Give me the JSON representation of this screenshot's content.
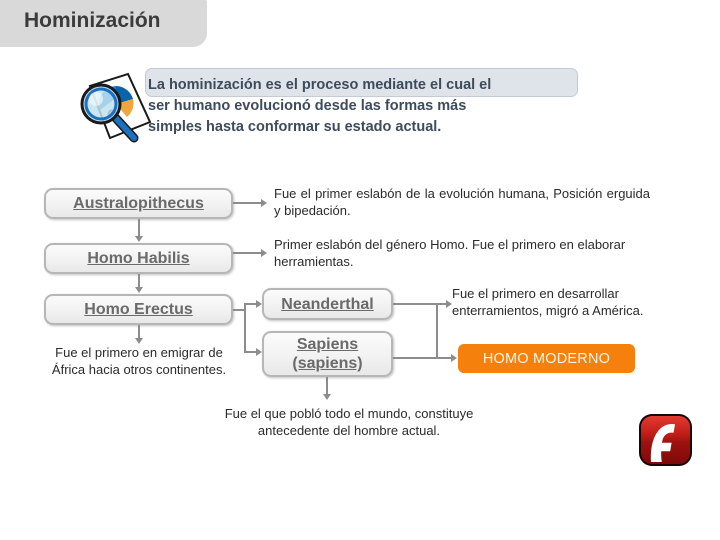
{
  "slide": {
    "title": "Hominización",
    "background_color": "#ffffff",
    "title_tab_color": "#d9d9d9"
  },
  "intro": {
    "icon": "magnifier-document-icon",
    "panel_color": "#dfe4ea",
    "text_color": "#3d4b5c",
    "text": "La hominización es el proceso mediante el cual el\nser humano evolucionó desde las formas más\nsimples hasta conformar su estado actual."
  },
  "diagram": {
    "node_border_color": "#b6b6b6",
    "node_text_color": "#6a6a6a",
    "connector_color": "#8c8c8c",
    "nodes": [
      {
        "id": "australopithecus",
        "label": "Australopithecus"
      },
      {
        "id": "homo-habilis",
        "label": "Homo Habilis"
      },
      {
        "id": "homo-erectus",
        "label": "Homo Erectus"
      },
      {
        "id": "neanderthal",
        "label": "Neanderthal"
      },
      {
        "id": "sapiens",
        "label": "Sapiens\n(sapiens)"
      }
    ],
    "highlight_node": {
      "id": "homo-moderno",
      "label": "HOMO MODERNO",
      "fill_color": "#f5800c",
      "text_color": "#fdf6ea"
    },
    "captions": [
      {
        "id": "australopithecus",
        "text": "Fue el primer eslabón de la evolución humana, Posición erguida y bipedación."
      },
      {
        "id": "homo-habilis",
        "text": "Primer eslabón del género Homo. Fue el primero en elaborar herramientas."
      },
      {
        "id": "homo-erectus",
        "text": "Fue el primero en emigrar de África hacia otros continentes."
      },
      {
        "id": "neanderthal",
        "text": "Fue el primero en desarrollar enterramientos, migró a América."
      },
      {
        "id": "sapiens",
        "text": "Fue el que pobló todo el mundo, constituye antecedente del hombre actual."
      }
    ]
  },
  "branding": {
    "flash_logo": "adobe-flash-logo",
    "flash_logo_color": "#b81717"
  }
}
